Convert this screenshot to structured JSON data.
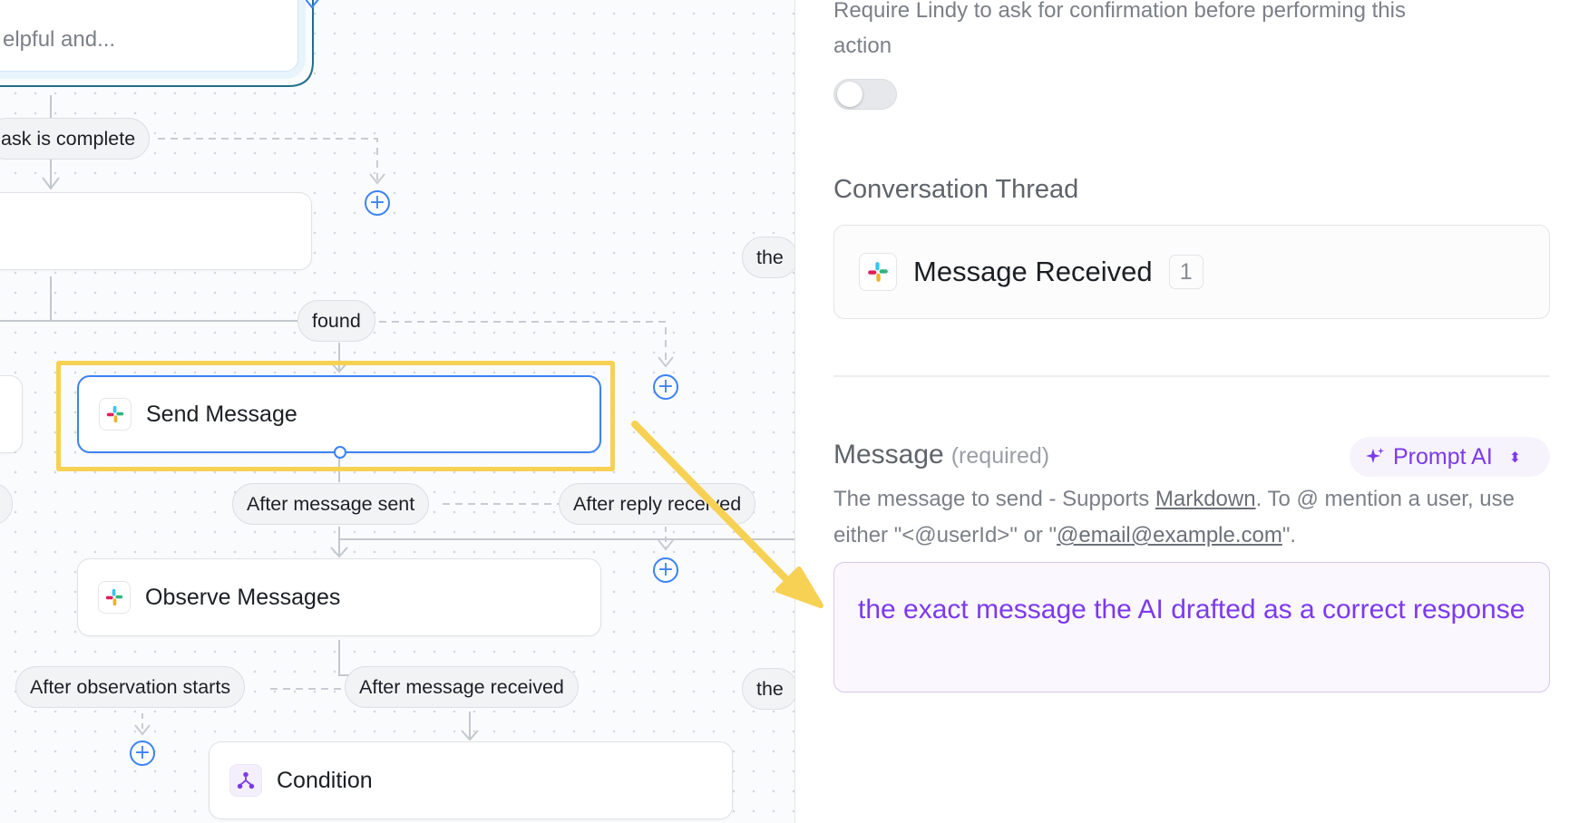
{
  "canvas": {
    "nodes": {
      "top_partial_text": "elpful and...",
      "send_message": "Send Message",
      "observe_messages": "Observe Messages",
      "condition": "Condition"
    },
    "pills": {
      "task_complete": "ask is complete",
      "found": "found",
      "the_upper": "the",
      "after_message_sent": "After message sent",
      "after_reply_received": "After reply received",
      "after_observation_starts": "After observation starts",
      "after_message_received": "After message received",
      "the_lower": "the"
    },
    "plus_glyph": "+",
    "highlight_color": "#f7d154",
    "arrow_color": "#f7d154"
  },
  "panel": {
    "confirmation_text": "Require Lindy to ask for confirmation before performing this",
    "confirmation_text_2": "action",
    "toggle_on": false,
    "conversation_thread_title": "Conversation Thread",
    "thread_item_label": "Message Received",
    "thread_item_count": "1",
    "message_title": "Message",
    "message_required": "(required)",
    "prompt_ai_label": "Prompt AI",
    "message_desc_1": "The message to send - Supports ",
    "message_desc_link": "Markdown",
    "message_desc_2": ". To @ mention a user, use either \"<@userId>\" or \"",
    "message_desc_email": "@email@example.com",
    "message_desc_3": "\".",
    "message_value": "the exact message the AI drafted as a correct response",
    "accent_color": "#7c3aed"
  }
}
